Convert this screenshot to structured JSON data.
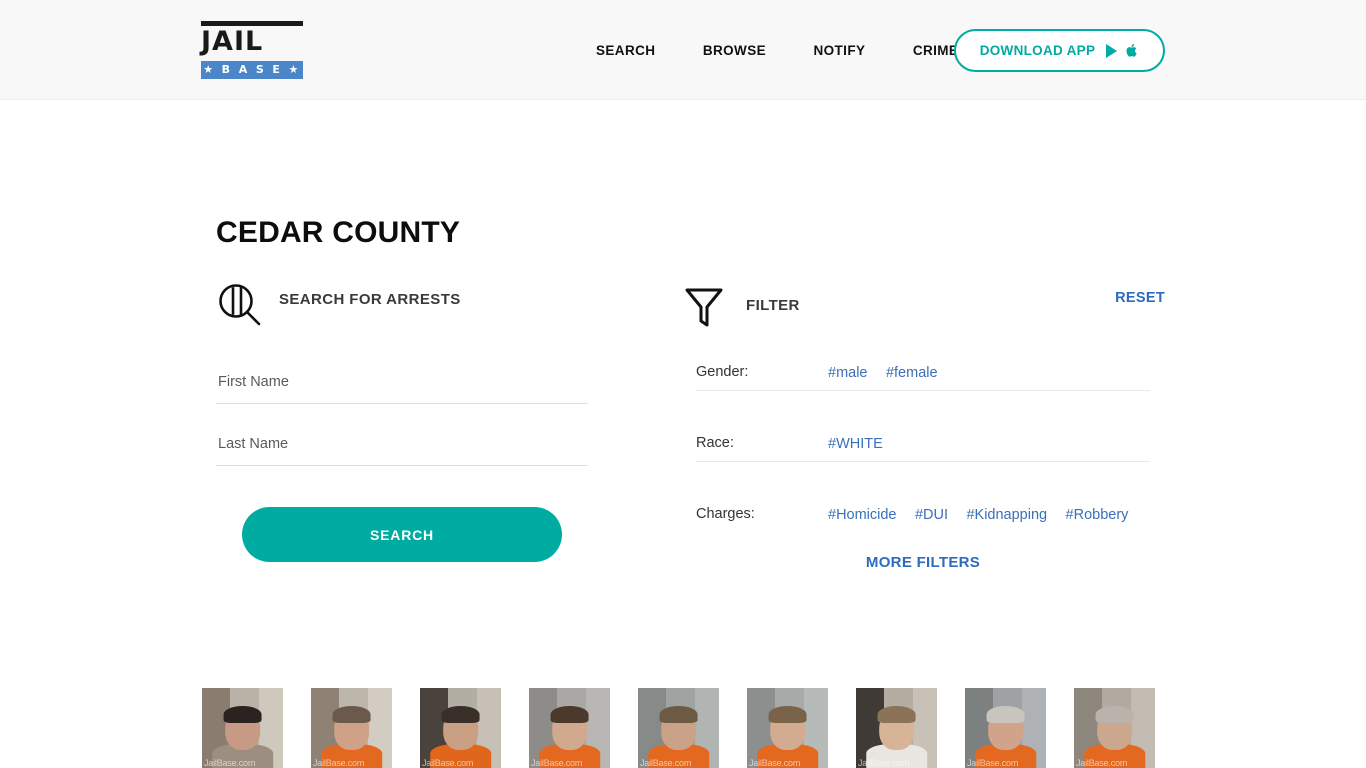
{
  "header": {
    "logo": {
      "top_text": "JAIL",
      "bottom_text": "★ B A S E ★"
    },
    "nav": [
      {
        "label": "SEARCH",
        "name": "nav-search"
      },
      {
        "label": "BROWSE",
        "name": "nav-browse"
      },
      {
        "label": "NOTIFY",
        "name": "nav-notify"
      },
      {
        "label": "CRIME STATS",
        "name": "nav-crime-stats"
      }
    ],
    "download_button": {
      "label": "DOWNLOAD APP",
      "icons": [
        "google-play-icon",
        "apple-icon"
      ],
      "accent_color": "#00aba1"
    }
  },
  "page": {
    "title": "CEDAR COUNTY"
  },
  "search_panel": {
    "icon": "magnifier-icon",
    "title": "SEARCH FOR ARRESTS",
    "first_name": {
      "value": "",
      "placeholder": "First Name"
    },
    "last_name": {
      "value": "",
      "placeholder": "Last Name"
    },
    "submit_label": "SEARCH",
    "submit_color": "#00aba1"
  },
  "filter_panel": {
    "icon": "funnel-icon",
    "title": "FILTER",
    "reset_label": "RESET",
    "reset_color": "#2c6bbf",
    "link_color": "#3b6fb8",
    "rows": [
      {
        "label": "Gender:",
        "tags": [
          "#male",
          "#female"
        ]
      },
      {
        "label": "Race:",
        "tags": [
          "#WHITE"
        ]
      },
      {
        "label": "Charges:",
        "tags": [
          "#Homicide",
          "#DUI",
          "#Kidnapping",
          "#Robbery"
        ]
      }
    ],
    "more_filters_label": "MORE FILTERS"
  },
  "mugshots": {
    "watermark": "JailBase.com",
    "items": [
      {
        "name": "mugshot-1",
        "bg": "#b9b2a6",
        "wall_l": "#8a7d70",
        "wall_r": "#cfc8bc",
        "skin": "#c79a85",
        "hair": "#2b2320",
        "shirt": "#9c8e80"
      },
      {
        "name": "mugshot-2",
        "bg": "#bdb6ab",
        "wall_l": "#8f8275",
        "wall_r": "#d3ccc2",
        "skin": "#cfa288",
        "hair": "#6b5a4c",
        "shirt": "#e2691f"
      },
      {
        "name": "mugshot-3",
        "bg": "#b3aea4",
        "wall_l": "#4a423c",
        "wall_r": "#c6c0b6",
        "skin": "#caa084",
        "hair": "#3a2f28",
        "shirt": "#e0661c"
      },
      {
        "name": "mugshot-4",
        "bg": "#a9a8a4",
        "wall_l": "#8d8c88",
        "wall_r": "#b8b7b3",
        "skin": "#d0a98f",
        "hair": "#4b3a2c",
        "shirt": "#e2691f"
      },
      {
        "name": "mugshot-5",
        "bg": "#9fa3a1",
        "wall_l": "#868a88",
        "wall_r": "#b0b4b2",
        "skin": "#caa287",
        "hair": "#6d5a44",
        "shirt": "#e2691f"
      },
      {
        "name": "mugshot-6",
        "bg": "#a6aaa8",
        "wall_l": "#8b8f8d",
        "wall_r": "#b6bab8",
        "skin": "#d2ab90",
        "hair": "#7a6348",
        "shirt": "#e2691f"
      },
      {
        "name": "mugshot-7",
        "bg": "#b4ada2",
        "wall_l": "#3f3a35",
        "wall_r": "#c8c1b7",
        "skin": "#d7b398",
        "hair": "#8a7358",
        "shirt": "#e8e6e1"
      },
      {
        "name": "mugshot-8",
        "bg": "#9ea2a4",
        "wall_l": "#7c807f",
        "wall_r": "#aeb2b4",
        "skin": "#cfa48a",
        "hair": "#c9c4bd",
        "shirt": "#e2691f"
      },
      {
        "name": "mugshot-9",
        "bg": "#b0aaa0",
        "wall_l": "#8e877d",
        "wall_r": "#c2bcb2",
        "skin": "#cba78d",
        "hair": "#b9b3ab",
        "shirt": "#e2691f"
      }
    ]
  }
}
